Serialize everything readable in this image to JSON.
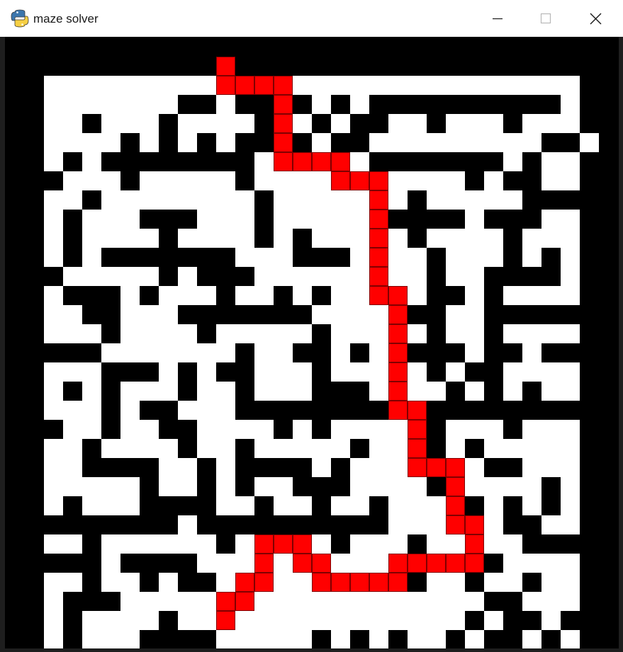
{
  "window": {
    "title": "maze solver",
    "app_icon": "python-icon",
    "buttons": [
      "minimize",
      "maximize",
      "close"
    ]
  },
  "maze": {
    "grid_size": 30,
    "wall_color": "#000000",
    "open_color": "#ffffff",
    "path_color": "#ff0000",
    "path_outline_color": "#800000",
    "walls": [
      [
        [
          0,
          29
        ]
      ],
      [
        [
          0,
          0
        ],
        [
          10,
          10
        ],
        [
          29,
          29
        ]
      ],
      [
        [
          0,
          0
        ],
        [
          8,
          9
        ],
        [
          11,
          12
        ],
        [
          14,
          14
        ],
        [
          16,
          16
        ],
        [
          18,
          27
        ],
        [
          29,
          29
        ]
      ],
      [
        [
          0,
          0
        ],
        [
          3,
          3
        ],
        [
          7,
          7
        ],
        [
          12,
          12
        ],
        [
          15,
          15
        ],
        [
          17,
          18
        ],
        [
          21,
          21
        ],
        [
          25,
          25
        ],
        [
          29,
          29
        ]
      ],
      [
        [
          0,
          0
        ],
        [
          5,
          5
        ],
        [
          7,
          7
        ],
        [
          9,
          9
        ],
        [
          11,
          12
        ],
        [
          14,
          14
        ],
        [
          16,
          17
        ],
        [
          27,
          28
        ]
      ],
      [
        [
          0,
          0
        ],
        [
          2,
          2
        ],
        [
          4,
          11
        ],
        [
          16,
          16
        ],
        [
          18,
          24
        ],
        [
          26,
          26
        ],
        [
          29,
          29
        ]
      ],
      [
        [
          0,
          1
        ],
        [
          5,
          5
        ],
        [
          11,
          11
        ],
        [
          16,
          16
        ],
        [
          23,
          23
        ],
        [
          25,
          26
        ],
        [
          29,
          29
        ]
      ],
      [
        [
          0,
          0
        ],
        [
          3,
          3
        ],
        [
          12,
          12
        ],
        [
          20,
          20
        ],
        [
          26,
          29
        ]
      ],
      [
        [
          0,
          0
        ],
        [
          2,
          2
        ],
        [
          6,
          8
        ],
        [
          12,
          12
        ],
        [
          19,
          22
        ],
        [
          24,
          26
        ],
        [
          29,
          29
        ]
      ],
      [
        [
          0,
          0
        ],
        [
          2,
          2
        ],
        [
          7,
          7
        ],
        [
          12,
          12
        ],
        [
          14,
          14
        ],
        [
          20,
          20
        ],
        [
          25,
          25
        ],
        [
          29,
          29
        ]
      ],
      [
        [
          0,
          0
        ],
        [
          2,
          2
        ],
        [
          4,
          10
        ],
        [
          14,
          16
        ],
        [
          21,
          21
        ],
        [
          25,
          25
        ],
        [
          27,
          27
        ],
        [
          29,
          29
        ]
      ],
      [
        [
          0,
          1
        ],
        [
          7,
          7
        ],
        [
          9,
          11
        ],
        [
          18,
          18
        ],
        [
          21,
          21
        ],
        [
          24,
          27
        ],
        [
          29,
          29
        ]
      ],
      [
        [
          0,
          0
        ],
        [
          2,
          4
        ],
        [
          6,
          6
        ],
        [
          10,
          10
        ],
        [
          13,
          13
        ],
        [
          15,
          15
        ],
        [
          21,
          22
        ],
        [
          24,
          24
        ],
        [
          29,
          29
        ]
      ],
      [
        [
          0,
          0
        ],
        [
          3,
          4
        ],
        [
          8,
          14
        ],
        [
          20,
          21
        ],
        [
          24,
          29
        ]
      ],
      [
        [
          0,
          0
        ],
        [
          4,
          4
        ],
        [
          9,
          9
        ],
        [
          15,
          15
        ],
        [
          21,
          21
        ],
        [
          24,
          24
        ],
        [
          29,
          29
        ]
      ],
      [
        [
          0,
          3
        ],
        [
          11,
          11
        ],
        [
          14,
          15
        ],
        [
          17,
          17
        ],
        [
          20,
          22
        ],
        [
          24,
          25
        ],
        [
          27,
          29
        ]
      ],
      [
        [
          0,
          0
        ],
        [
          4,
          6
        ],
        [
          8,
          8
        ],
        [
          10,
          11
        ],
        [
          15,
          15
        ],
        [
          21,
          21
        ],
        [
          23,
          24
        ],
        [
          29,
          29
        ]
      ],
      [
        [
          0,
          0
        ],
        [
          2,
          2
        ],
        [
          4,
          4
        ],
        [
          8,
          8
        ],
        [
          11,
          11
        ],
        [
          15,
          17
        ],
        [
          22,
          22
        ],
        [
          24,
          24
        ],
        [
          26,
          26
        ],
        [
          29,
          29
        ]
      ],
      [
        [
          0,
          0
        ],
        [
          4,
          4
        ],
        [
          6,
          7
        ],
        [
          11,
          18
        ],
        [
          21,
          29
        ]
      ],
      [
        [
          0,
          1
        ],
        [
          4,
          4
        ],
        [
          7,
          8
        ],
        [
          13,
          13
        ],
        [
          15,
          15
        ],
        [
          21,
          21
        ],
        [
          25,
          25
        ],
        [
          29,
          29
        ]
      ],
      [
        [
          0,
          0
        ],
        [
          3,
          3
        ],
        [
          8,
          8
        ],
        [
          11,
          11
        ],
        [
          17,
          17
        ],
        [
          21,
          21
        ],
        [
          23,
          23
        ],
        [
          29,
          29
        ]
      ],
      [
        [
          0,
          0
        ],
        [
          3,
          6
        ],
        [
          9,
          9
        ],
        [
          11,
          14
        ],
        [
          16,
          16
        ],
        [
          21,
          21
        ],
        [
          24,
          25
        ],
        [
          29,
          29
        ]
      ],
      [
        [
          0,
          0
        ],
        [
          6,
          6
        ],
        [
          9,
          9
        ],
        [
          11,
          11
        ],
        [
          14,
          16
        ],
        [
          21,
          21
        ],
        [
          27,
          27
        ],
        [
          29,
          29
        ]
      ],
      [
        [
          0,
          0
        ],
        [
          2,
          2
        ],
        [
          6,
          9
        ],
        [
          12,
          12
        ],
        [
          15,
          15
        ],
        [
          18,
          18
        ],
        [
          23,
          23
        ],
        [
          25,
          25
        ],
        [
          27,
          27
        ],
        [
          29,
          29
        ]
      ],
      [
        [
          0,
          7
        ],
        [
          9,
          18
        ],
        [
          22,
          23
        ],
        [
          25,
          26
        ],
        [
          29,
          29
        ]
      ],
      [
        [
          0,
          0
        ],
        [
          3,
          3
        ],
        [
          10,
          10
        ],
        [
          12,
          12
        ],
        [
          14,
          14
        ],
        [
          16,
          16
        ],
        [
          20,
          20
        ],
        [
          23,
          23
        ],
        [
          26,
          29
        ]
      ],
      [
        [
          0,
          3
        ],
        [
          5,
          8
        ],
        [
          23,
          24
        ],
        [
          29,
          29
        ]
      ],
      [
        [
          0,
          0
        ],
        [
          3,
          3
        ],
        [
          6,
          6
        ],
        [
          8,
          9
        ],
        [
          16,
          20
        ],
        [
          23,
          23
        ],
        [
          26,
          26
        ],
        [
          29,
          29
        ]
      ],
      [
        [
          0,
          0
        ],
        [
          2,
          4
        ],
        [
          24,
          25
        ],
        [
          29,
          29
        ]
      ],
      [
        [
          0,
          0
        ],
        [
          2,
          2
        ],
        [
          7,
          7
        ],
        [
          23,
          23
        ],
        [
          25,
          26
        ],
        [
          28,
          29
        ]
      ],
      [
        [
          0,
          0
        ],
        [
          2,
          2
        ],
        [
          6,
          9
        ],
        [
          15,
          15
        ],
        [
          17,
          17
        ],
        [
          19,
          19
        ],
        [
          22,
          22
        ],
        [
          24,
          25
        ],
        [
          27,
          27
        ],
        [
          29,
          29
        ]
      ],
      [
        [
          0,
          29
        ]
      ]
    ],
    "path": [
      [
        0,
        10
      ],
      [
        1,
        10
      ],
      [
        1,
        11
      ],
      [
        1,
        12
      ],
      [
        1,
        13
      ],
      [
        2,
        13
      ],
      [
        3,
        13
      ],
      [
        4,
        13
      ],
      [
        5,
        13
      ],
      [
        5,
        14
      ],
      [
        5,
        15
      ],
      [
        5,
        16
      ],
      [
        6,
        16
      ],
      [
        6,
        17
      ],
      [
        6,
        18
      ],
      [
        7,
        18
      ],
      [
        8,
        18
      ],
      [
        9,
        18
      ],
      [
        10,
        18
      ],
      [
        11,
        18
      ],
      [
        12,
        18
      ],
      [
        12,
        19
      ],
      [
        13,
        19
      ],
      [
        14,
        19
      ],
      [
        15,
        19
      ],
      [
        16,
        19
      ],
      [
        17,
        19
      ],
      [
        18,
        19
      ],
      [
        18,
        20
      ],
      [
        19,
        20
      ],
      [
        20,
        20
      ],
      [
        21,
        20
      ],
      [
        21,
        21
      ],
      [
        21,
        22
      ],
      [
        22,
        22
      ],
      [
        23,
        22
      ],
      [
        24,
        22
      ],
      [
        24,
        23
      ],
      [
        25,
        23
      ],
      [
        26,
        23
      ],
      [
        26,
        22
      ],
      [
        26,
        21
      ],
      [
        26,
        20
      ],
      [
        26,
        19
      ],
      [
        27,
        19
      ],
      [
        27,
        18
      ],
      [
        27,
        17
      ],
      [
        27,
        16
      ],
      [
        27,
        15
      ],
      [
        26,
        15
      ],
      [
        26,
        14
      ],
      [
        25,
        14
      ],
      [
        25,
        13
      ],
      [
        25,
        12
      ],
      [
        26,
        12
      ],
      [
        27,
        12
      ],
      [
        27,
        11
      ],
      [
        28,
        11
      ],
      [
        28,
        10
      ],
      [
        29,
        10
      ]
    ]
  }
}
